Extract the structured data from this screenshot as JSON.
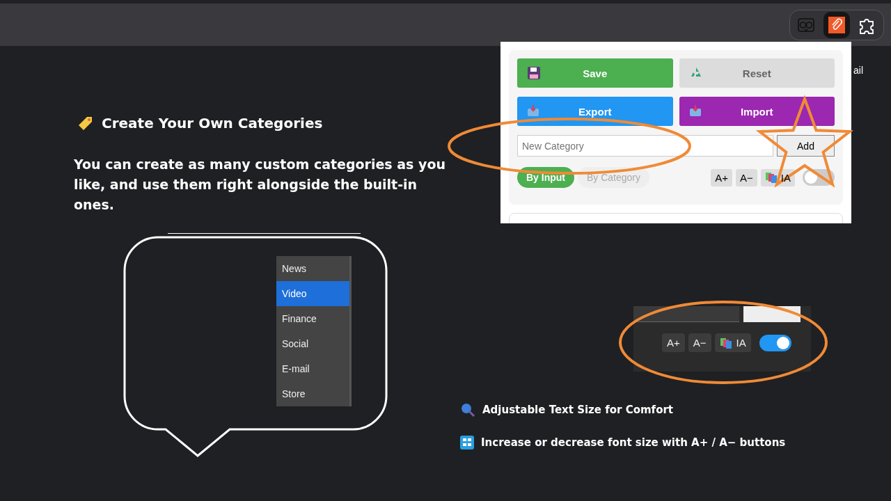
{
  "toolbar": {
    "extensions": [
      {
        "kind": "owl",
        "selected": false
      },
      {
        "kind": "clip",
        "selected": true
      },
      {
        "kind": "puzzle",
        "selected": false
      }
    ]
  },
  "background_text": "ail",
  "heading": "Create Your Own Categories",
  "description": "You can create as many custom categories as you like, and use them right alongside the built-in ones.",
  "category_menu": [
    {
      "label": "News",
      "selected": false
    },
    {
      "label": "Video",
      "selected": true
    },
    {
      "label": "Finance",
      "selected": false
    },
    {
      "label": "Social",
      "selected": false
    },
    {
      "label": "E-mail",
      "selected": false
    },
    {
      "label": "Store",
      "selected": false
    }
  ],
  "popup": {
    "buttons": [
      {
        "label": "Save",
        "kind": "save",
        "color": "#4caf50"
      },
      {
        "label": "Reset",
        "kind": "reset",
        "color": "#dcdcdc"
      },
      {
        "label": "Export",
        "kind": "export",
        "color": "#2196f3"
      },
      {
        "label": "Import",
        "kind": "import",
        "color": "#9c27b0"
      }
    ],
    "new_category": {
      "placeholder": "New Category"
    },
    "add_button": "Add",
    "modes": [
      {
        "label": "By Input",
        "selected": true
      },
      {
        "label": "By Category",
        "selected": false
      }
    ],
    "font_buttons": [
      "A+",
      "A−"
    ],
    "ia_button": "IA",
    "toggle": {
      "on": false
    }
  },
  "dark_panel": {
    "font_buttons": [
      "A+",
      "A−"
    ],
    "ia_button": "IA",
    "toggle": {
      "on": true
    }
  },
  "features": [
    {
      "kind": "search",
      "text": "Adjustable Text Size for Comfort"
    },
    {
      "kind": "abcd",
      "text": "Increase or decrease font size with A+ / A− buttons"
    }
  ]
}
